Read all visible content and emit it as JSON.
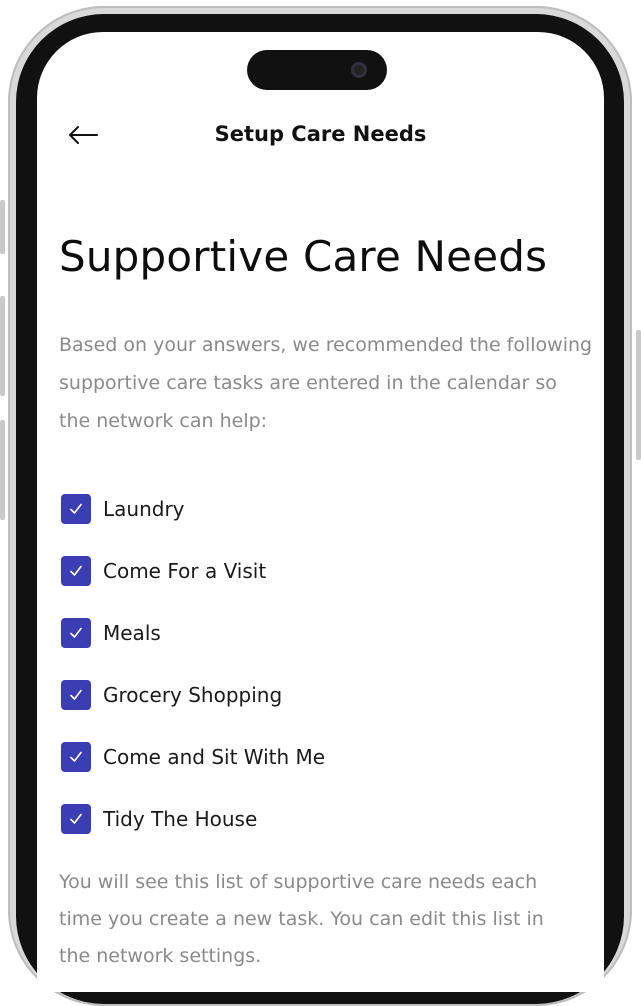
{
  "header": {
    "title": "Setup Care Needs",
    "back_icon": "arrow-left-icon"
  },
  "main": {
    "title": "Supportive Care Needs",
    "intro": "Based on your answers, we recommended the following supportive care tasks are entered in the calendar so the network can help:",
    "care_needs": [
      {
        "label": "Laundry",
        "checked": true
      },
      {
        "label": "Come For a Visit",
        "checked": true
      },
      {
        "label": "Meals",
        "checked": true
      },
      {
        "label": "Grocery Shopping",
        "checked": true
      },
      {
        "label": "Come and Sit With Me",
        "checked": true
      },
      {
        "label": "Tidy The House",
        "checked": true
      }
    ],
    "footer_note": "You will see this list of supportive care needs each time you create a new task. You can edit this list in the network settings."
  },
  "colors": {
    "accent": "#3b3db3",
    "muted_text": "#8a8a8a",
    "frame": "#111111"
  }
}
